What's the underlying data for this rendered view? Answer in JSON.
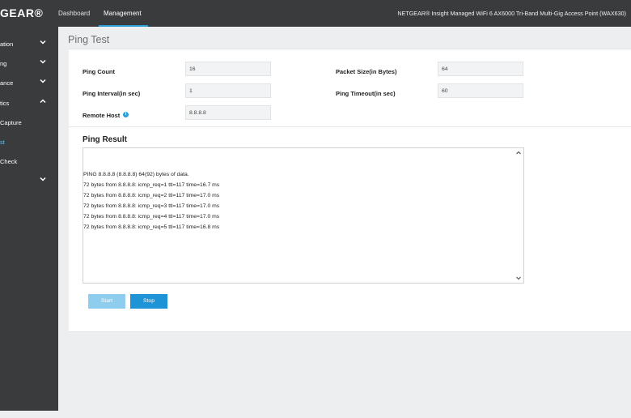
{
  "header": {
    "logo": "GEAR®",
    "tabs": [
      {
        "label": "Dashboard",
        "active": false
      },
      {
        "label": "Management",
        "active": true
      }
    ],
    "device_title": "NETGEAR® Insight Managed WiFi 6 AX6000 Tri-Band Multi-Gig Access Point (WAX630)"
  },
  "sidebar": {
    "items": [
      {
        "label": "ation",
        "icon": "chevron-down-icon"
      },
      {
        "label": "ng",
        "icon": "chevron-down-icon"
      },
      {
        "label": "ance",
        "icon": "chevron-down-icon"
      },
      {
        "label": "tics",
        "icon": "chevron-up-icon"
      },
      {
        "label": "Capture"
      },
      {
        "label": "st",
        "active": true
      },
      {
        "label": "Check"
      },
      {
        "label": "",
        "icon": "chevron-down-icon"
      }
    ]
  },
  "page": {
    "title": "Ping Test",
    "fields": {
      "ping_count": {
        "label": "Ping Count",
        "value": "16"
      },
      "packet_size": {
        "label": "Packet Size(in Bytes)",
        "value": "64"
      },
      "ping_interval": {
        "label": "Ping Interval(in sec)",
        "value": "1"
      },
      "ping_timeout": {
        "label": "Ping Timeout(in sec)",
        "value": "60"
      },
      "remote_host": {
        "label": "Remote Host",
        "value": "8.8.8.8",
        "icon": "info-icon"
      }
    },
    "result": {
      "title": "Ping Result",
      "lines": [
        "PING 8.8.8.8 (8.8.8.8) 64(92) bytes of data.",
        "72 bytes from 8.8.8.8: icmp_req=1 ttl=117 time=16.7 ms",
        "72 bytes from 8.8.8.8: icmp_req=2 ttl=117 time=17.0 ms",
        "72 bytes from 8.8.8.8: icmp_req=3 ttl=117 time=17.0 ms",
        "72 bytes from 8.8.8.8: icmp_req=4 ttl=117 time=17.0 ms",
        "72 bytes from 8.8.8.8: icmp_req=5 ttl=117 time=16.8 ms"
      ]
    },
    "buttons": {
      "start": "Start",
      "stop": "Stop"
    }
  },
  "colors": {
    "accent": "#1e93d6",
    "nav_bg": "#3a3b3d",
    "active_link": "#5dc0f0"
  }
}
